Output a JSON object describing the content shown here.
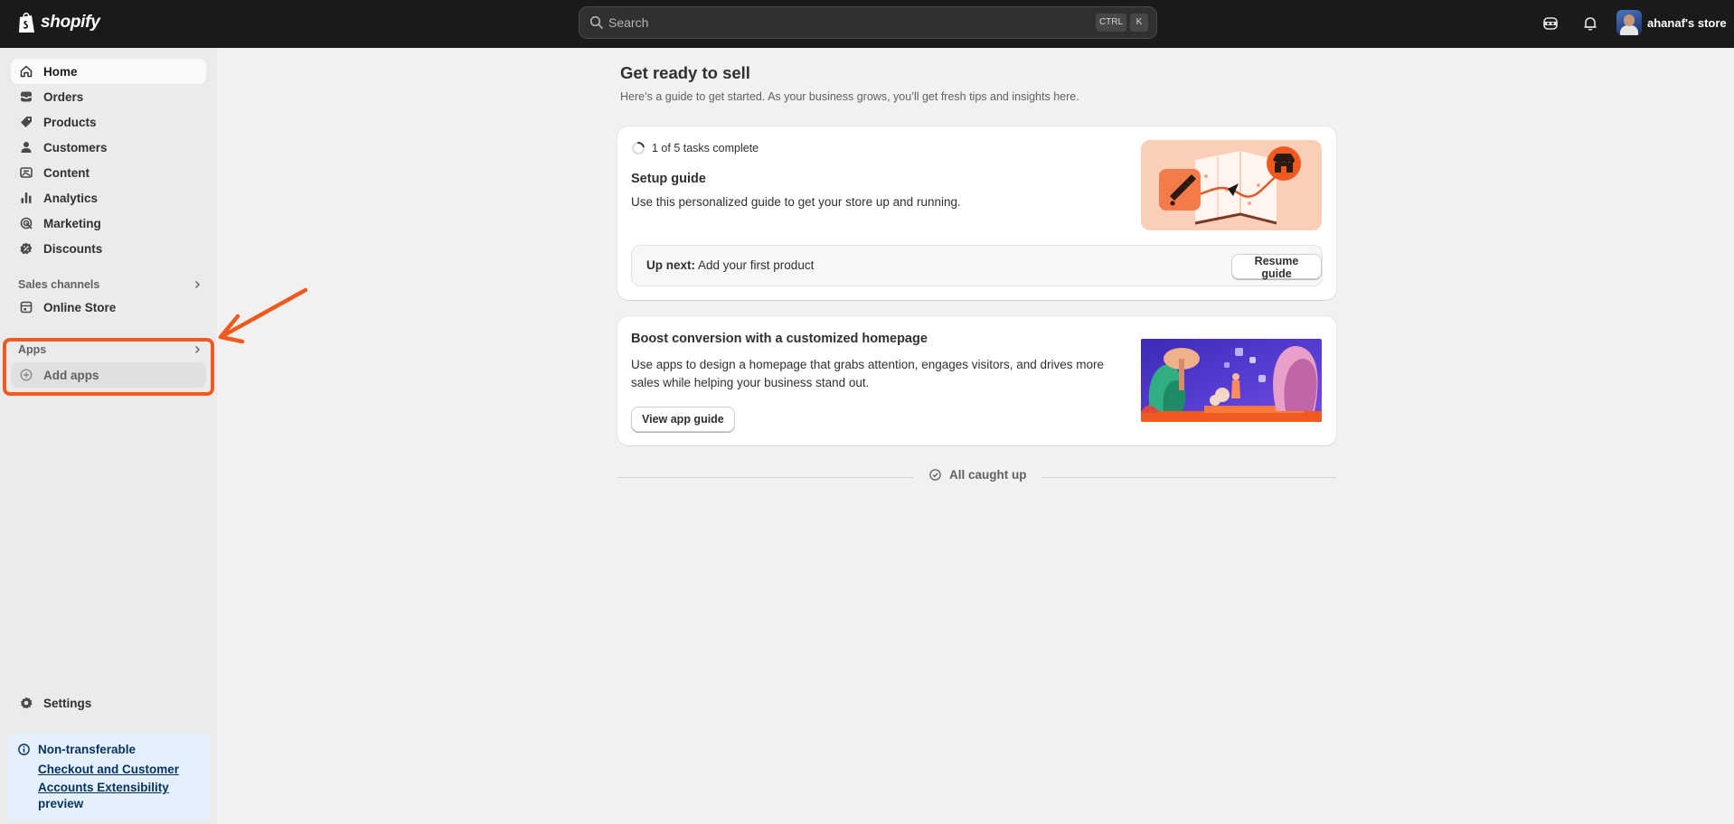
{
  "topbar": {
    "brand": "shopify",
    "search_placeholder": "Search",
    "shortcut_ctrl": "CTRL",
    "shortcut_k": "K",
    "store_name": "ahanaf's store"
  },
  "sidebar": {
    "items": [
      {
        "label": "Home",
        "icon": "home-icon"
      },
      {
        "label": "Orders",
        "icon": "inbox-icon"
      },
      {
        "label": "Products",
        "icon": "tag-icon"
      },
      {
        "label": "Customers",
        "icon": "person-icon"
      },
      {
        "label": "Content",
        "icon": "image-icon"
      },
      {
        "label": "Analytics",
        "icon": "bar-chart-icon"
      },
      {
        "label": "Marketing",
        "icon": "target-icon"
      },
      {
        "label": "Discounts",
        "icon": "discount-icon"
      }
    ],
    "sales_channels_label": "Sales channels",
    "online_store_label": "Online Store",
    "apps_label": "Apps",
    "add_apps_label": "Add apps",
    "settings_label": "Settings",
    "banner": {
      "title": "Non-transferable",
      "link": "Checkout and Customer Accounts Extensibility",
      "tail": "preview"
    }
  },
  "main": {
    "title": "Get ready to sell",
    "subtitle": "Here’s a guide to get started. As your business grows, you’ll get fresh tips and insights here.",
    "setup_card": {
      "progress": "1 of 5 tasks complete",
      "progress_fraction": 0.2,
      "title": "Setup guide",
      "description": "Use this personalized guide to get your store up and running.",
      "up_next_label": "Up next:",
      "up_next_value": "Add your first product",
      "button": "Resume guide"
    },
    "boost_card": {
      "title": "Boost conversion with a customized homepage",
      "description_line1": "Use apps to design a homepage that grabs attention, engages visitors, and drives more",
      "description_line2": "sales while helping your business stand out.",
      "button": "View app guide"
    },
    "caught_up": "All caught up"
  },
  "colors": {
    "topbar": "#1a1a1a",
    "highlight": "#f15a1f",
    "banner_bg": "#e5f0fd"
  }
}
